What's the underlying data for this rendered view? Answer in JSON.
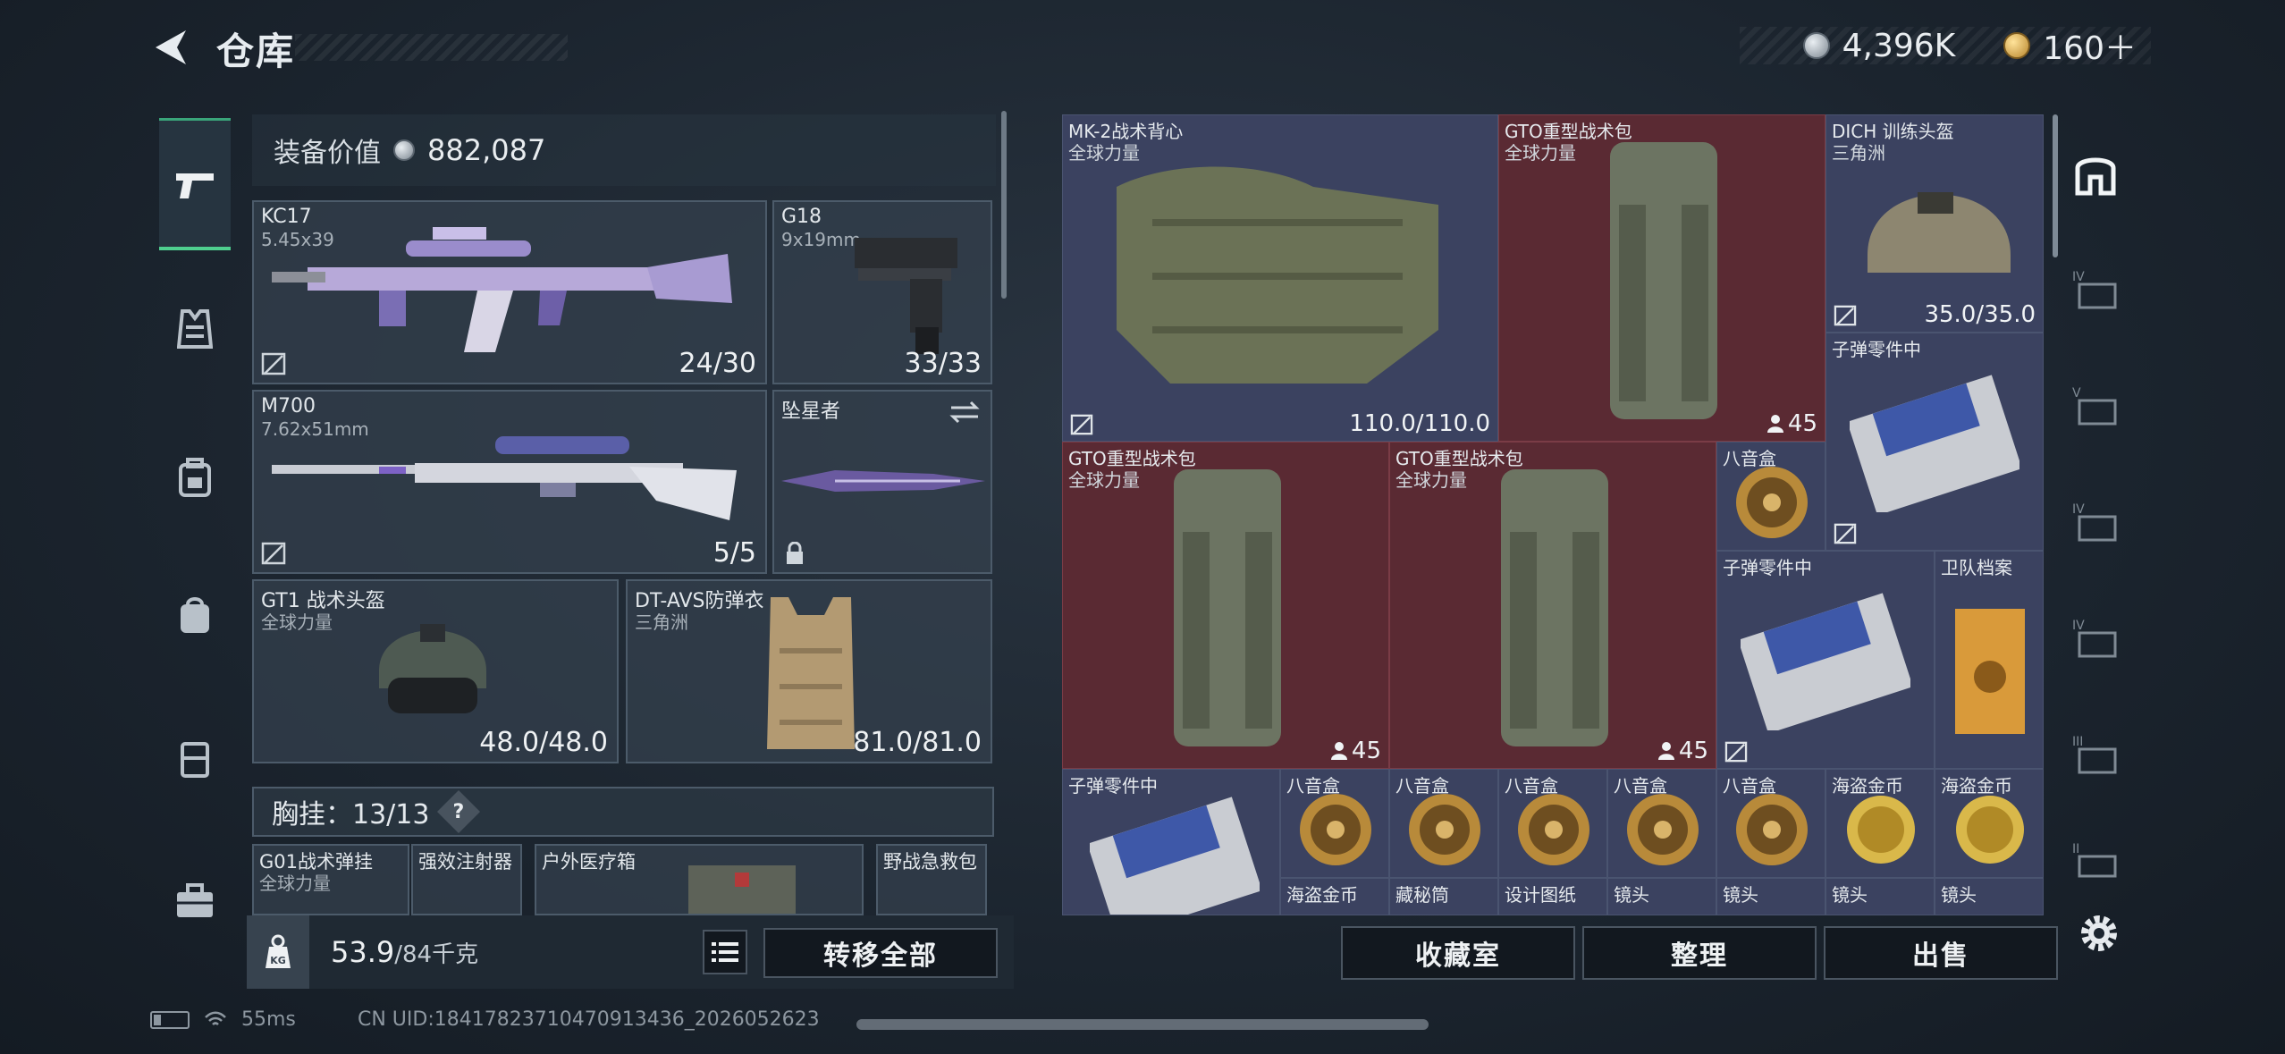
{
  "header": {
    "title": "仓库",
    "currency_silver": "4,396K",
    "currency_gold": "160＋"
  },
  "rail": {
    "items": [
      "pistol-icon",
      "vest-icon",
      "backpack-icon",
      "bag-icon",
      "case-icon",
      "toolbox-icon"
    ]
  },
  "equip": {
    "value_label": "装备价值",
    "value": "882,087",
    "primary": {
      "name": "KC17",
      "caliber": "5.45x39",
      "ammo": "24/30"
    },
    "sidearm": {
      "name": "G18",
      "caliber": "9x19mm",
      "ammo": "33/33"
    },
    "secondary": {
      "name": "M700",
      "caliber": "7.62x51mm",
      "ammo": "5/5"
    },
    "melee": {
      "name": "坠星者"
    },
    "helmet": {
      "name": "GT1 战术头盔",
      "sub": "全球力量",
      "durability": "48.0/48.0"
    },
    "armor": {
      "name": "DT-AVS防弹衣",
      "sub": "三角洲",
      "durability": "81.0/81.0"
    },
    "chest_label": "胸挂：13/13",
    "help": "?",
    "chest_items": [
      {
        "name": "G01战术弹挂",
        "sub": "全球力量"
      },
      {
        "name": "强效注射器"
      },
      {
        "name": "户外医疗箱"
      },
      {
        "name": "野战急救包"
      }
    ]
  },
  "footer_left": {
    "weight": "53.9",
    "weight_max": "/84千克",
    "transfer_all": "转移全部"
  },
  "stash": {
    "items": [
      {
        "name": "MK-2战术背心",
        "sub": "全球力量",
        "val": "110.0/110.0"
      },
      {
        "name": "GTO重型战术包",
        "sub": "全球力量",
        "count": "45"
      },
      {
        "name": "DICH 训练头盔",
        "sub": "三角洲",
        "val": "35.0/35.0"
      },
      {
        "name": "子弹零件中"
      },
      {
        "name": "GTO重型战术包",
        "sub": "全球力量",
        "count": "45"
      },
      {
        "name": "GTO重型战术包",
        "sub": "全球力量",
        "count": "45"
      },
      {
        "name": "八音盒"
      },
      {
        "name": "子弹零件中"
      },
      {
        "name": "卫队档案"
      },
      {
        "name": "子弹零件中"
      },
      {
        "name": "八音盒"
      },
      {
        "name": "八音盒"
      },
      {
        "name": "八音盒"
      },
      {
        "name": "八音盒"
      },
      {
        "name": "八音盒"
      },
      {
        "name": "海盗金币"
      },
      {
        "name": "海盗金币"
      },
      {
        "name": "海盗金币"
      },
      {
        "name": "藏秘筒"
      },
      {
        "name": "设计图纸"
      },
      {
        "name": "镜头"
      },
      {
        "name": "镜头"
      },
      {
        "name": "镜头"
      },
      {
        "name": "镜头"
      }
    ]
  },
  "footer_right": {
    "collection": "收藏室",
    "organize": "整理",
    "sell": "出售"
  },
  "status": {
    "ping": "55ms",
    "uid": "CN UID:18417823710470913436_2026052623"
  },
  "colors": {
    "accent_green": "#4fcf8f",
    "red_cell": "#5a2a33",
    "blue_cell": "#363f58"
  }
}
